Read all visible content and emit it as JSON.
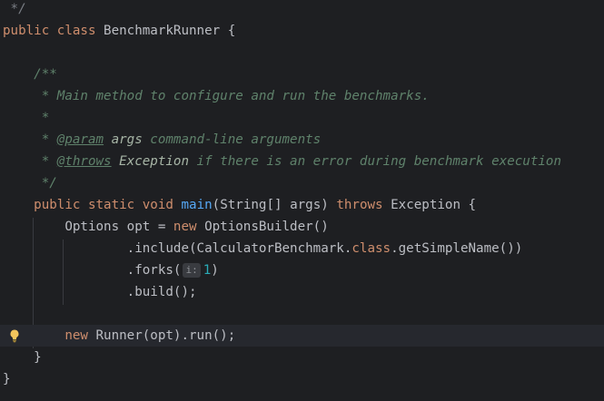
{
  "editor": {
    "lines": [
      {
        "segments": [
          {
            "t": " */",
            "c": "cm"
          }
        ]
      },
      {
        "segments": [
          {
            "t": "public",
            "c": "kw"
          },
          {
            "t": " "
          },
          {
            "t": "class",
            "c": "kw"
          },
          {
            "t": " BenchmarkRunner {"
          }
        ]
      },
      {
        "segments": []
      },
      {
        "segments": [
          {
            "t": "    "
          },
          {
            "t": "/**",
            "c": "doc"
          }
        ]
      },
      {
        "segments": [
          {
            "t": "     * Main method to configure and run the benchmarks.",
            "c": "doc"
          }
        ]
      },
      {
        "segments": [
          {
            "t": "     *",
            "c": "doc"
          }
        ]
      },
      {
        "segments": [
          {
            "t": "     * ",
            "c": "doc"
          },
          {
            "t": "@param",
            "c": "tag"
          },
          {
            "t": " "
          },
          {
            "t": "args",
            "c": "pn"
          },
          {
            "t": " command-line arguments",
            "c": "doc"
          }
        ]
      },
      {
        "segments": [
          {
            "t": "     * ",
            "c": "doc"
          },
          {
            "t": "@throws",
            "c": "tag"
          },
          {
            "t": " "
          },
          {
            "t": "Exception",
            "c": "pn"
          },
          {
            "t": " if there is an error during benchmark execution",
            "c": "doc"
          }
        ]
      },
      {
        "segments": [
          {
            "t": "     */",
            "c": "doc"
          }
        ]
      },
      {
        "segments": [
          {
            "t": "    "
          },
          {
            "t": "public",
            "c": "kw"
          },
          {
            "t": " "
          },
          {
            "t": "static",
            "c": "kw"
          },
          {
            "t": " "
          },
          {
            "t": "void",
            "c": "kw"
          },
          {
            "t": " "
          },
          {
            "t": "main",
            "c": "fn"
          },
          {
            "t": "(String[] args) "
          },
          {
            "t": "throws",
            "c": "kw"
          },
          {
            "t": " Exception {"
          }
        ]
      },
      {
        "segments": [
          {
            "t": "        Options opt = "
          },
          {
            "t": "new",
            "c": "kw"
          },
          {
            "t": " OptionsBuilder()"
          }
        ]
      },
      {
        "segments": [
          {
            "t": "                .include(CalculatorBenchmark."
          },
          {
            "t": "class",
            "c": "kw"
          },
          {
            "t": ".getSimpleName())"
          }
        ]
      },
      {
        "segments": [
          {
            "t": "                .forks("
          },
          {
            "t": "i:",
            "c": "hint"
          },
          {
            "t": "1",
            "c": "num"
          },
          {
            "t": ")"
          }
        ]
      },
      {
        "segments": [
          {
            "t": "                .build();"
          }
        ]
      },
      {
        "segments": []
      },
      {
        "current": true,
        "bulb": true,
        "segments": [
          {
            "t": "        "
          },
          {
            "t": "new",
            "c": "kw"
          },
          {
            "t": " Runner(opt).run();"
          }
        ]
      },
      {
        "segments": [
          {
            "t": "    }"
          }
        ]
      },
      {
        "segments": [
          {
            "t": "}"
          }
        ]
      }
    ]
  },
  "colors": {
    "background": "#1e1f22",
    "current_line": "#26282e",
    "keyword": "#cf8e6d",
    "method": "#56a8f5",
    "javadoc": "#5f826b",
    "number": "#2aacb8",
    "text": "#bcbec4"
  },
  "icons": {
    "gutter": "lightbulb-icon"
  }
}
